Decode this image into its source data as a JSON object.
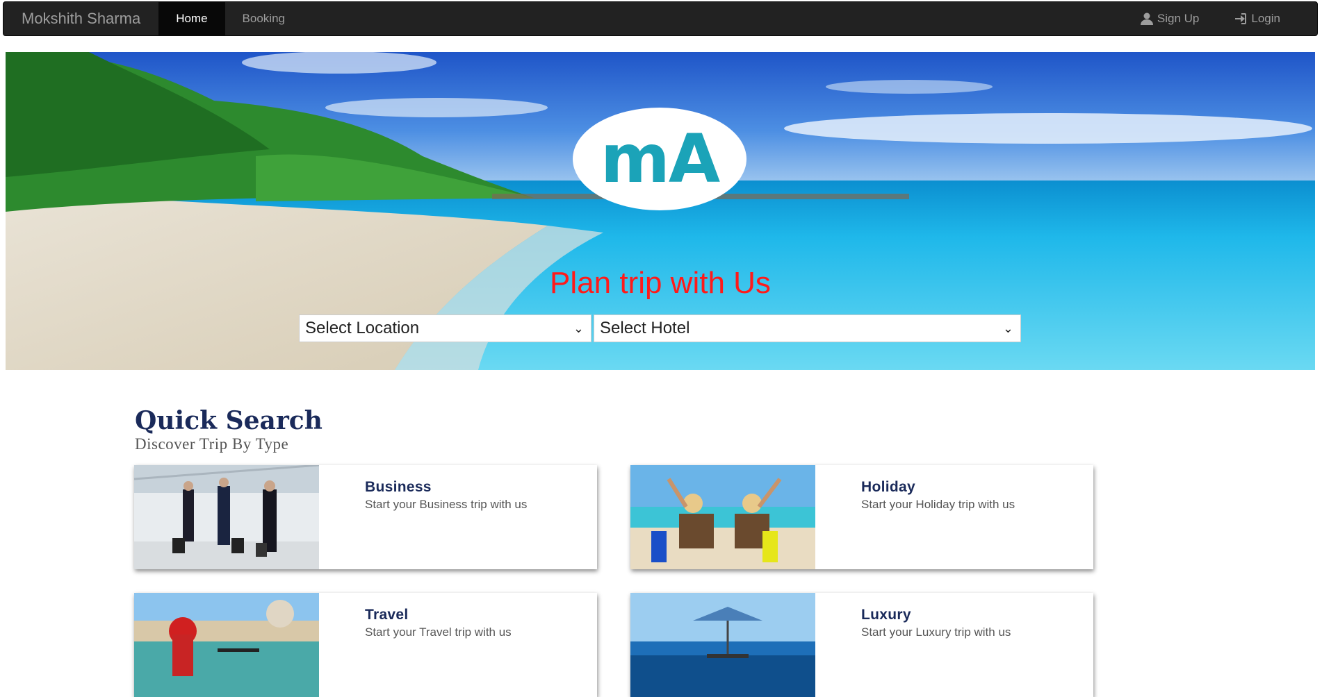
{
  "navbar": {
    "brand": "Mokshith Sharma",
    "links": [
      {
        "label": "Home",
        "active": true
      },
      {
        "label": "Booking",
        "active": false
      }
    ],
    "signup_label": "Sign Up",
    "login_label": "Login"
  },
  "hero": {
    "logo_text": "mA",
    "title": "Plan trip with Us",
    "location_select": "Select Location",
    "hotel_select": "Select Hotel"
  },
  "quick_search": {
    "title": "Quick Search",
    "subtitle": "Discover Trip By Type",
    "cards": [
      {
        "title": "Business",
        "desc": "Start your Business trip with us"
      },
      {
        "title": "Holiday",
        "desc": "Start your Holiday trip with us"
      },
      {
        "title": "Travel",
        "desc": "Start your Travel trip with us"
      },
      {
        "title": "Luxury",
        "desc": "Start your Luxury trip with us"
      }
    ]
  },
  "colors": {
    "navbar_bg": "#222222",
    "hero_title": "#ff1a1a",
    "logo_text": "#1ba3b8",
    "heading": "#1a2a5a"
  }
}
